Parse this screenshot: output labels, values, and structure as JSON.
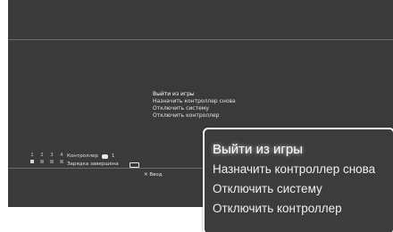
{
  "menu": {
    "items": [
      "Выйти из игры",
      "Назначить контроллер снова",
      "Отключить систему",
      "Отключить контроллер"
    ],
    "selected_index": 0
  },
  "status": {
    "ports": [
      "1",
      "2",
      "3",
      "4"
    ],
    "controller_label": "Контроллер",
    "controller_number": "1",
    "charge_label": "Зарядка завершена"
  },
  "hint": {
    "enter": "✕ Ввод"
  },
  "zoom": {
    "items": [
      "Выйти из игры",
      "Назначить контроллер снова",
      "Отключить систему",
      "Отключить контроллер"
    ]
  },
  "icons": {
    "controller": "gamepad-icon",
    "battery": "battery-icon"
  },
  "colors": {
    "background": "#3a3a3a",
    "text": "#e6e6e6",
    "highlight": "#ffffff"
  }
}
